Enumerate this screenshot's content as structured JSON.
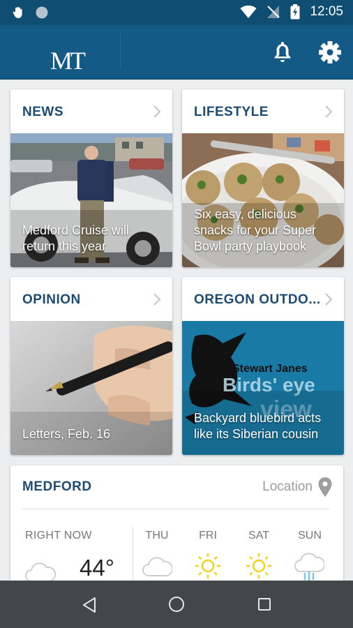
{
  "status_bar": {
    "time": "12:05"
  },
  "app": {
    "logo": "MT"
  },
  "sections": [
    {
      "title": "NEWS",
      "caption": "Medford Cruise will return this year"
    },
    {
      "title": "LIFESTYLE",
      "caption": "Six easy, delicious snacks for your Super Bowl party playbook"
    },
    {
      "title": "OPINION",
      "caption": "Letters, Feb. 16"
    },
    {
      "title": "OREGON OUTDO...",
      "caption": "Backyard bluebird acts like its Siberian cousin",
      "image_text_1": "Stewart Janes",
      "image_text_2": "Birds' eye",
      "image_text_3": "view"
    }
  ],
  "weather": {
    "city": "MEDFORD",
    "location_label": "Location",
    "now_label": "RIGHT NOW",
    "now_temp": "44°",
    "now_icon": "cloud-icon",
    "forecast": [
      {
        "day": "THU",
        "icon": "cloud-icon"
      },
      {
        "day": "FRI",
        "icon": "sun-icon"
      },
      {
        "day": "SAT",
        "icon": "sun-icon"
      },
      {
        "day": "SUN",
        "icon": "rain-icon"
      }
    ]
  },
  "colors": {
    "app_bar": "#145a86",
    "status_bar": "#0f4d73",
    "section_title": "#1c4b73",
    "sun": "#f5d21a",
    "nav_bar": "#444749"
  }
}
